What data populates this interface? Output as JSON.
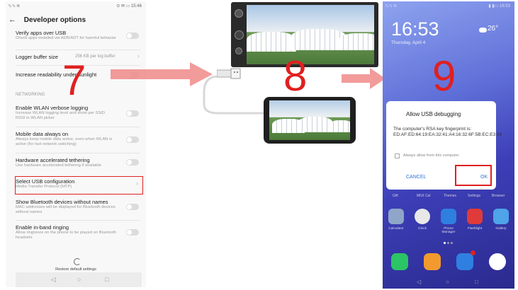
{
  "steps": [
    "7",
    "8",
    "9"
  ],
  "settings": {
    "status_left": "ᵛᵢₗ ᵛᵢₗ ≋",
    "status_right": "⊙ ✉ ▭ 15:46",
    "back_glyph": "←",
    "title": "Developer options",
    "rows": [
      {
        "title": "Verify apps over USB",
        "subtitle": "Check apps installed via ADB/ADT for harmful behavior"
      },
      {
        "title": "Logger buffer size",
        "value": "256 KB per log buffer"
      },
      {
        "title": "Increase readability under sunlight"
      },
      {
        "title": "Enable WLAN verbose logging",
        "subtitle": "Increase WLAN logging level and show per SSID RSSI in WLAN picker"
      },
      {
        "title": "Mobile data always on",
        "subtitle": "Always keep mobile data active, even when WLAN is active (for fast network switching)"
      },
      {
        "title": "Hardware accelerated tethering",
        "subtitle": "Use hardware accelerated tethering if available"
      },
      {
        "title": "Select USB configuration",
        "subtitle": "Media Transfer Protocol (MTP)"
      },
      {
        "title": "Show Bluetooth devices without names",
        "subtitle": "MAC addresses will be displayed for Bluetooth devices without names"
      },
      {
        "title": "Enable in-band ringing",
        "subtitle": "Allow ringtones on the phone to be played on Bluetooth headsets"
      }
    ],
    "section_networking": "NETWORKING",
    "restore_label": "Restore default settings",
    "nav": [
      "◁",
      "○",
      "□"
    ]
  },
  "lockscreen": {
    "status": "▮ ▮▭ 16:53",
    "status_left": "ᵛᵢₗ ᵛᵢₗ ≋",
    "time": "16:53",
    "date": "Thursday, April 4",
    "temp": "26°",
    "dialog": {
      "title": "Allow USB debugging",
      "body": "The computer's RSA key fingerprint is: ED:AF:ED:64:19:EA:32:41:A4:16:32:6F:5B:EC:E3:59",
      "checkbox": "Always allow from this computer",
      "cancel": "CANCEL",
      "ok": "OK"
    },
    "apps": [
      {
        "label": "Calculator",
        "color": "#8fa6c8"
      },
      {
        "label": "Clock",
        "color": "#e8e8e8"
      },
      {
        "label": "Phone Manager",
        "color": "#2f7fe0"
      },
      {
        "label": "Flashlight",
        "color": "#e03a3a"
      },
      {
        "label": "Gallery",
        "color": "#4fa3e8"
      }
    ],
    "dock": [
      {
        "color": "#2cc565"
      },
      {
        "color": "#f29a2e"
      },
      {
        "color": "#2f7fe0"
      },
      {
        "color": "#ffffff"
      }
    ],
    "faded_row": [
      "Gift",
      "MIUI Cal",
      "Themes",
      "Settings",
      "Browser"
    ],
    "nav": [
      "◁",
      "○",
      "□"
    ]
  }
}
